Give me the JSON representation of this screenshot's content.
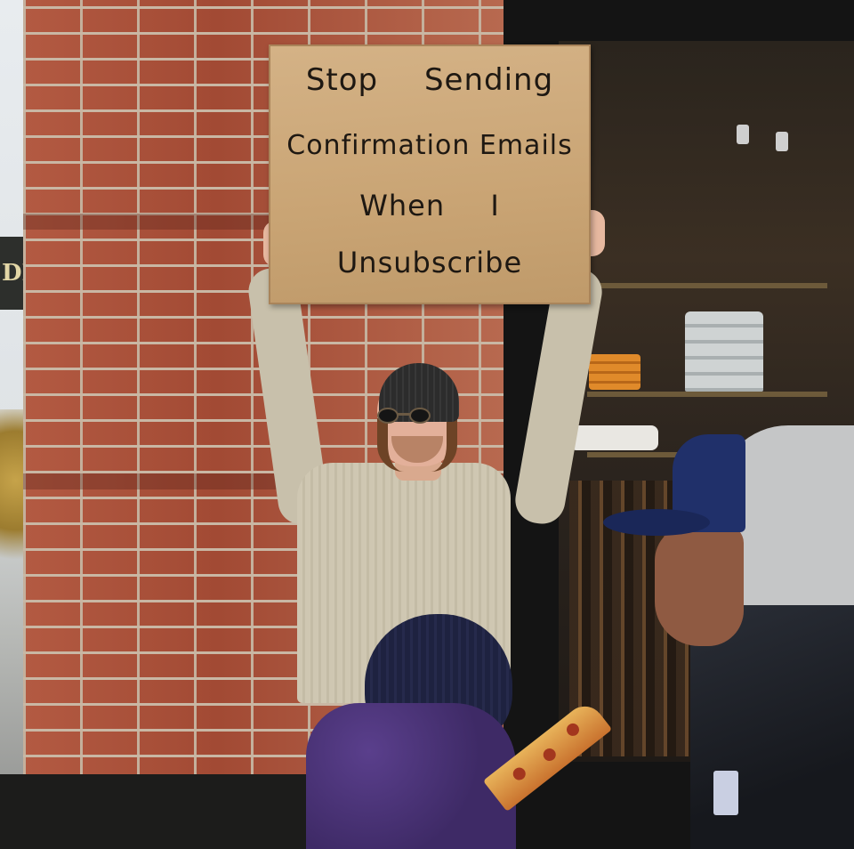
{
  "sign": {
    "line1": "Stop Sending",
    "line2": "Confirmation Emails",
    "line3": "When I",
    "line4": "Unsubscribe"
  },
  "background_sign": {
    "text": "DIT"
  },
  "colors": {
    "brick": "#a8503a",
    "cardboard": "#c9a474",
    "sweater": "#c8c0ab",
    "beanie": "#2c2c2c",
    "kid_coat": "#3e2a66",
    "cap": "#20306a",
    "storefront_frame": "#141414"
  }
}
